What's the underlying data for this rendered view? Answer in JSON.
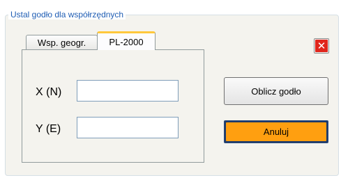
{
  "group": {
    "title": "Ustal godło dla współrzędnych"
  },
  "tabs": [
    {
      "label": "Wsp. geogr.",
      "active": false
    },
    {
      "label": "PL-2000",
      "active": true
    }
  ],
  "fields": {
    "x": {
      "label": "X (N)",
      "value": ""
    },
    "y": {
      "label": "Y (E)",
      "value": ""
    }
  },
  "buttons": {
    "close": {
      "icon": "close-icon",
      "color": "#e0261c"
    },
    "calculate": {
      "label": "Oblicz godło"
    },
    "cancel": {
      "label": "Anuluj",
      "color": "#ff9f10"
    }
  }
}
